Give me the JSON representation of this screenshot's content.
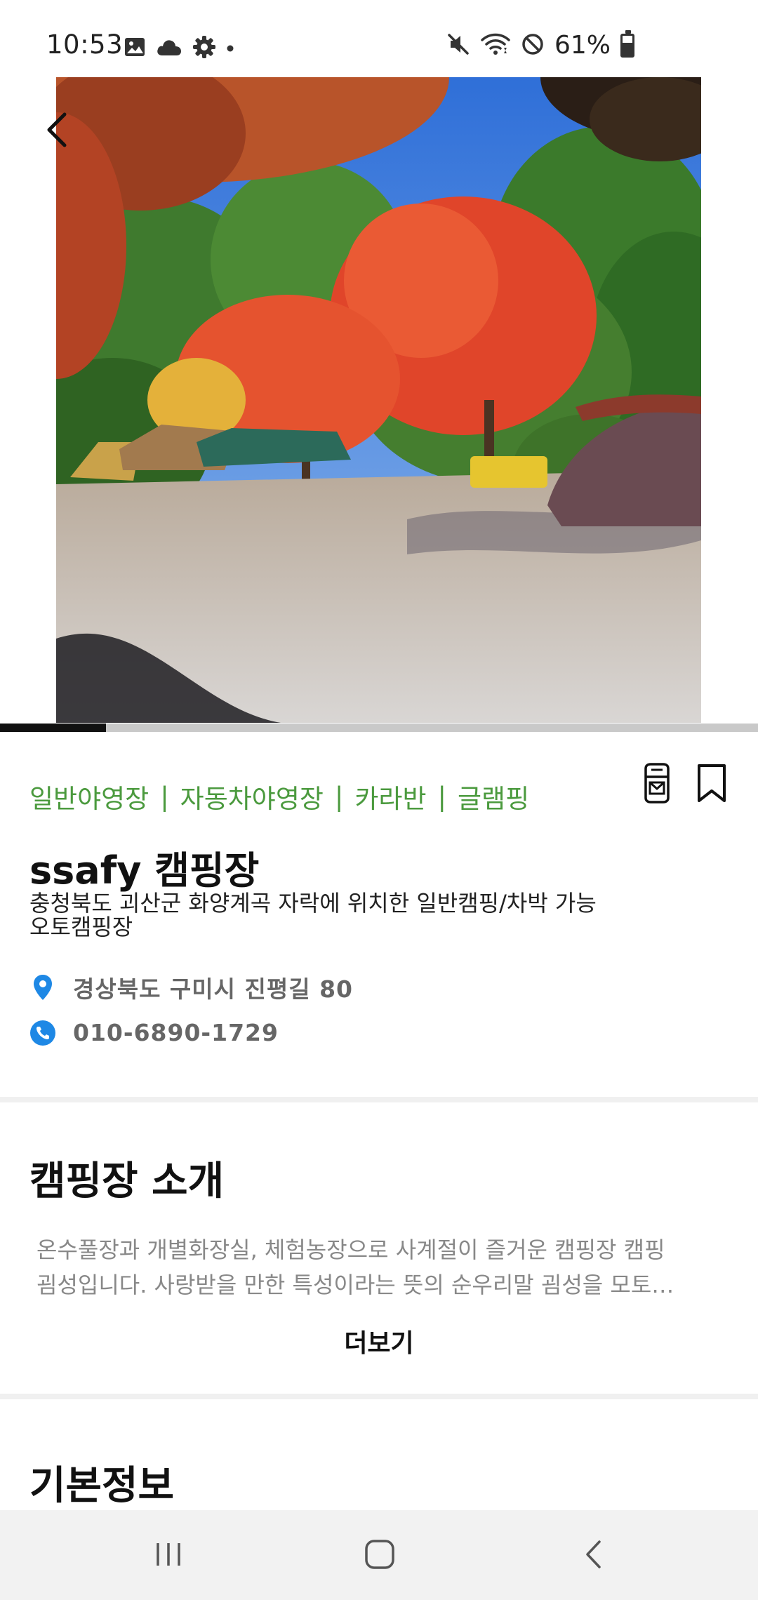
{
  "status_bar": {
    "time": "10:53",
    "battery": "61%",
    "battery_level": 0.61,
    "left_icons": [
      "gallery-icon",
      "cloud-icon",
      "settings-icon",
      "dot-icon"
    ],
    "right_icons": [
      "mute-icon",
      "wifi-icon",
      "do-not-disturb-icon",
      "battery-icon"
    ]
  },
  "gallery": {
    "current_index": 1,
    "total": 7,
    "progress": 0.14
  },
  "camp": {
    "tags": [
      "일반야영장",
      "자동차야영장",
      "카라반",
      "글램핑"
    ],
    "tag_separator": "|",
    "name": "ssafy 캠핑장",
    "description_line1": "충청북도 괴산군 화양계곡 자락에 위치한 일반캠핑/차박 가능",
    "description_line2": "오토캠핑장",
    "address": "경상북도 구미시 진평길 80",
    "phone": "010-6890-1729"
  },
  "intro": {
    "title": "캠핑장 소개",
    "line1": "온수풀장과 개별화장실, 체험농장으로 사계절이 즐거운 캠핑장 캠핑",
    "line2": "굄성입니다.  사랑받을 만한 특성이라는 뜻의 순우리말 굄성을 모토…",
    "more_label": "더보기"
  },
  "basic_info": {
    "title": "기본정보"
  },
  "colors": {
    "tag_green": "#4b9a3e",
    "location_blue": "#1e88e5",
    "phone_blue": "#1e88e5",
    "progress_fill": "#111111",
    "progress_track": "#c9c9c9"
  }
}
